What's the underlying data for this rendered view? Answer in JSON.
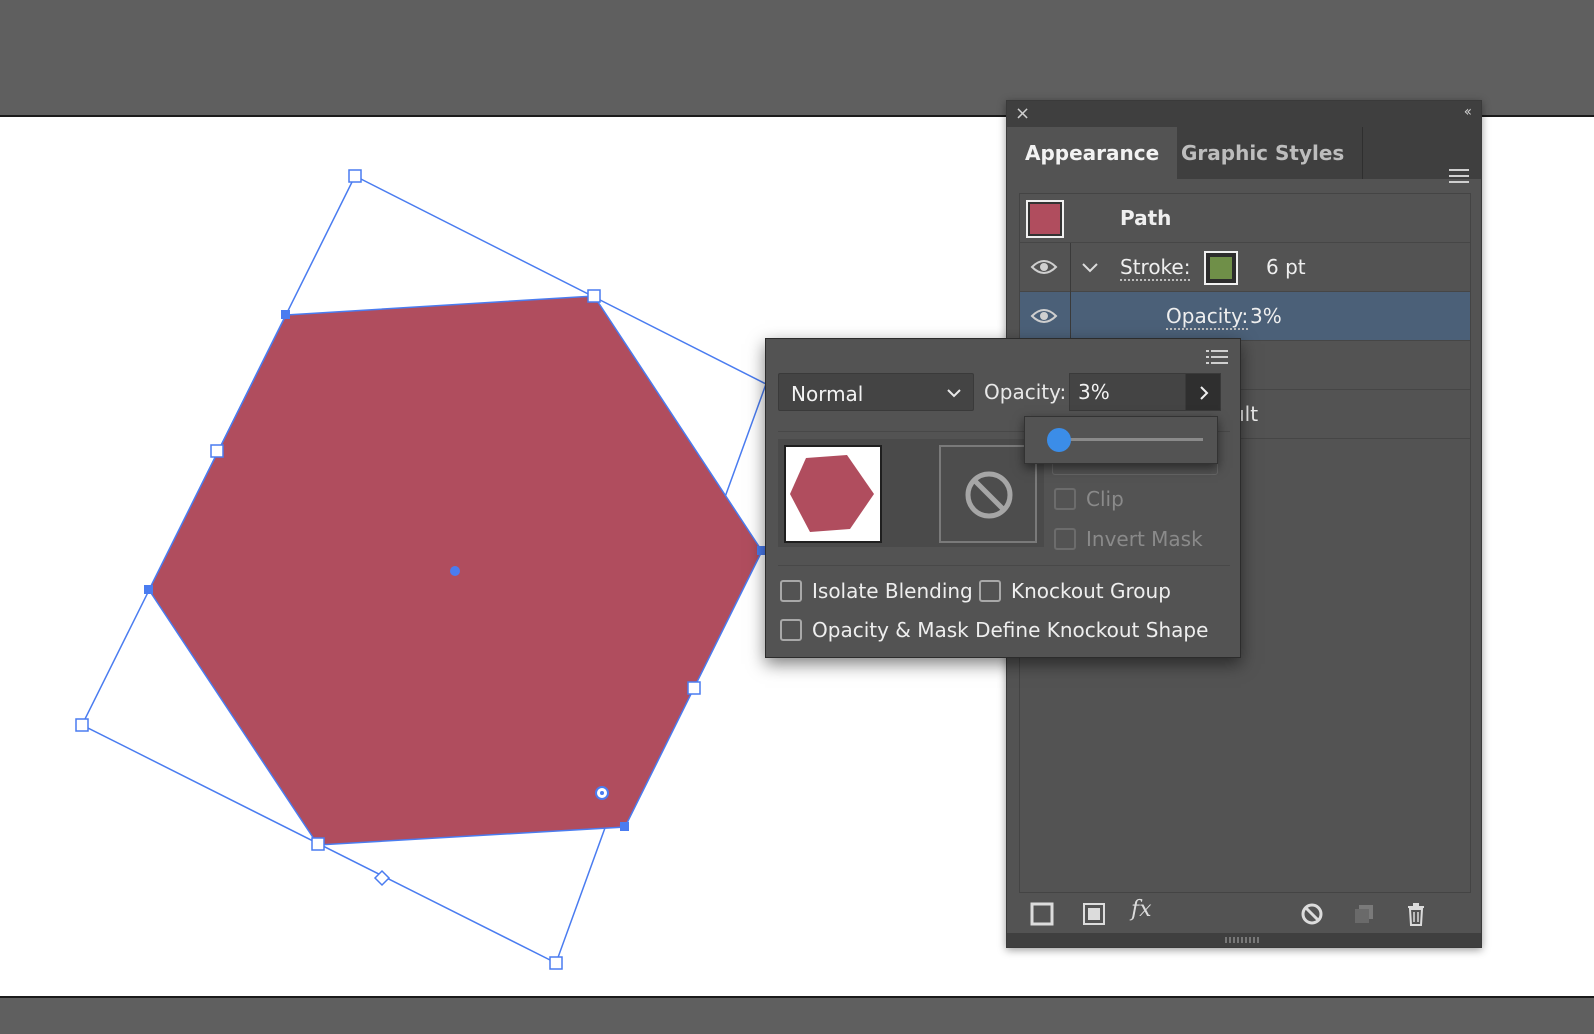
{
  "canvas": {
    "shape_fill": "#b04d5e",
    "selection_color": "#4a7cf0",
    "artboard_color": "#ffffff",
    "pasteboard_color": "#5f5f5f"
  },
  "appearance_panel": {
    "tabs": [
      {
        "label": "Appearance",
        "active": true
      },
      {
        "label": "Graphic Styles",
        "active": false
      }
    ],
    "icons": [
      "close-icon",
      "collapse-icon",
      "panel-menu-icon"
    ],
    "rows": {
      "path": {
        "label": "Path",
        "fill_color": "#b04d5e"
      },
      "stroke": {
        "label": "Stroke:",
        "value": "6 pt",
        "color": "#6f8f48"
      },
      "opacity": {
        "label": "Opacity:",
        "value": "3%"
      },
      "default_fragment": "ult"
    },
    "footer_icons": [
      "add-new-stroke-icon",
      "add-new-fill-icon",
      "add-effect-icon",
      "clear-appearance-icon",
      "duplicate-item-icon",
      "delete-item-icon"
    ],
    "footer_fx_label": "fx"
  },
  "transparency": {
    "blend_mode": "Normal",
    "opacity_label": "Opacity:",
    "opacity_value": "3%",
    "opacity_slider_percent": 3,
    "clip_label": "Clip",
    "invert_mask_label": "Invert Mask",
    "isolate_label": "Isolate Blending",
    "knockout_label": "Knockout Group",
    "define_knockout_label": "Opacity & Mask Define Knockout Shape",
    "isolate_checked": false,
    "knockout_checked": false,
    "define_knockout_checked": false
  }
}
